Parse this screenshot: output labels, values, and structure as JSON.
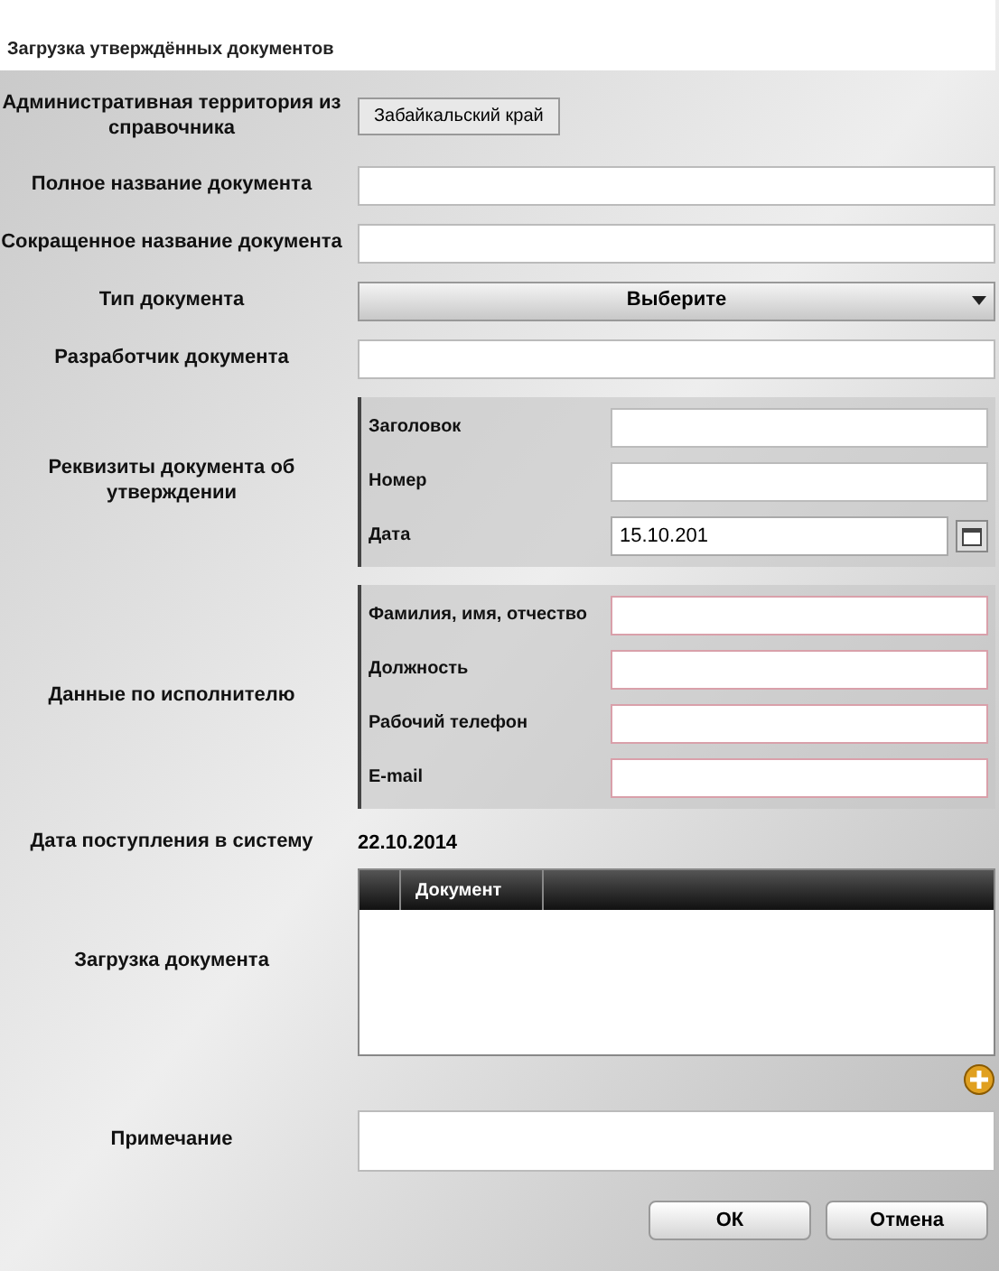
{
  "window": {
    "title": "Загрузка утверждённых документов"
  },
  "territory": {
    "label": "Административная территория из справочника",
    "value": "Забайкальский край"
  },
  "fields": [
    {
      "label": "Полное название документа",
      "kind": "text"
    },
    {
      "label": "Сокращенное название документа",
      "kind": "text"
    },
    {
      "label": "Тип документа",
      "kind": "select",
      "value": "Выберите"
    },
    {
      "label": "Разработчик документа",
      "kind": "text"
    }
  ],
  "groups": [
    {
      "label": "Реквизиты документа об утверждении",
      "fields": [
        {
          "label": "Заголовок",
          "kind": "text"
        },
        {
          "label": "Номер",
          "kind": "text"
        },
        {
          "label": "Дата",
          "kind": "date",
          "value": "15.10.201"
        }
      ]
    },
    {
      "label": "Данные по исполнителю",
      "fields": [
        {
          "label": "Фамилия, имя, отчество",
          "kind": "required"
        },
        {
          "label": "Должность",
          "kind": "required"
        },
        {
          "label": "Рабочий телефон",
          "kind": "required"
        },
        {
          "label": "E-mail",
          "kind": "required"
        }
      ]
    }
  ],
  "received": {
    "label": "Дата поступления в систему",
    "value": "22.10.2014"
  },
  "upload": {
    "label": "Загрузка документа",
    "columns": [
      "Документ"
    ]
  },
  "note": {
    "label": "Примечание"
  },
  "buttons": [
    "ОК",
    "Отмена"
  ]
}
